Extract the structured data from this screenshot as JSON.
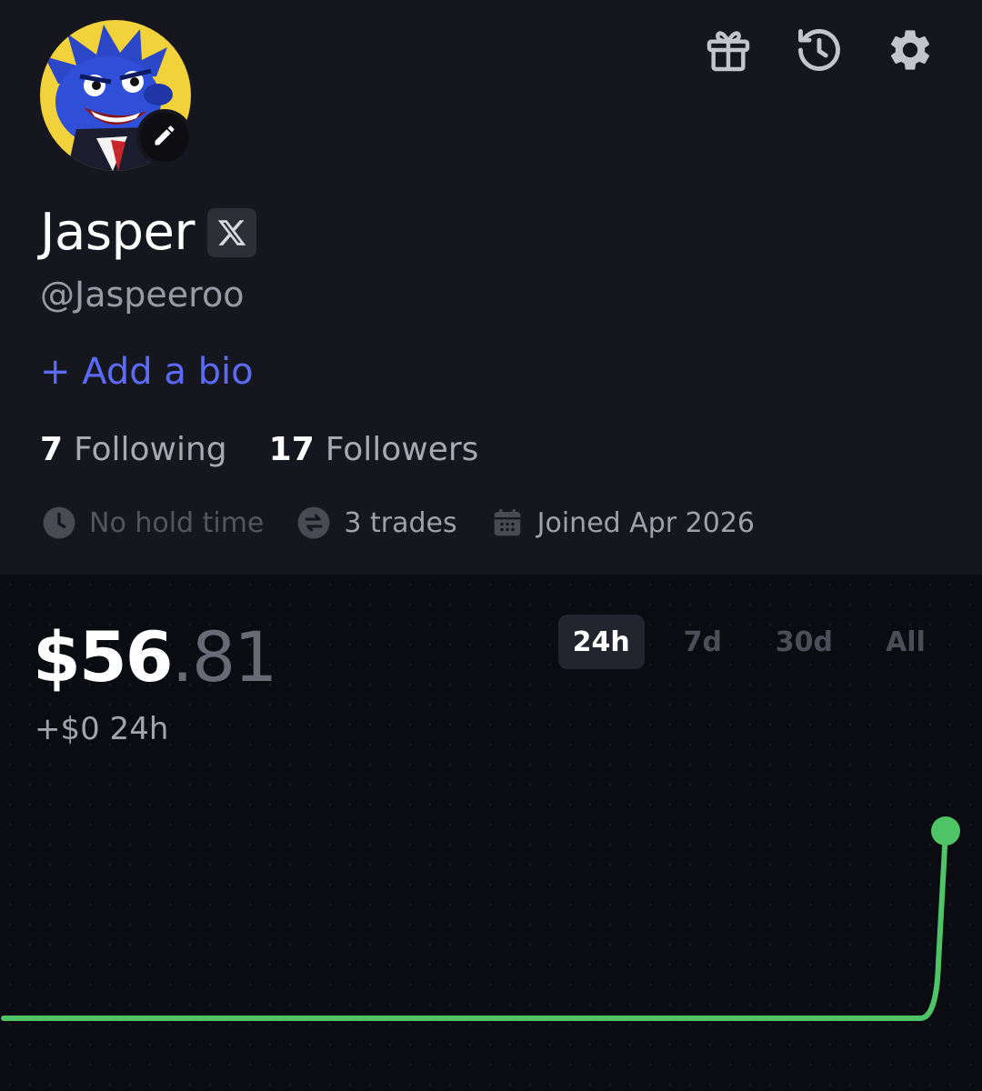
{
  "header": {
    "icons": [
      "gift-icon",
      "history-icon",
      "settings-icon"
    ]
  },
  "profile": {
    "name": "Jasper",
    "handle": "@Jaspeeroo",
    "add_bio": "+ Add a bio",
    "following_count": "7",
    "following_label": "Following",
    "followers_count": "17",
    "followers_label": "Followers",
    "meta": {
      "hold_time": "No hold time",
      "trades": "3 trades",
      "joined": "Joined Apr 2026"
    }
  },
  "portfolio": {
    "balance_whole": "$56",
    "balance_cents": ".81",
    "change": "+$0 24h",
    "ranges": [
      "24h",
      "7d",
      "30d",
      "All"
    ],
    "active_range": "24h"
  },
  "chart_data": {
    "type": "line",
    "series": [
      {
        "values": [
          0,
          0,
          0,
          0,
          0,
          0,
          0,
          0,
          0,
          0,
          0,
          0,
          56.81
        ]
      }
    ],
    "ylim": [
      0,
      56.81
    ],
    "color": "#4fc466"
  },
  "colors": {
    "accent": "#5b6bf7",
    "positive": "#4fc466",
    "bg": "#16161e"
  }
}
